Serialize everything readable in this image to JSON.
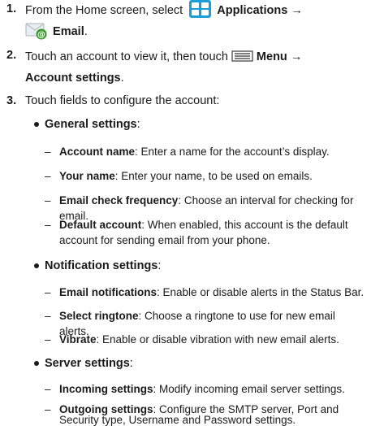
{
  "steps": [
    {
      "number": "1.",
      "line1_prefix": "From the Home screen, select",
      "applications_label": "Applications",
      "arrow": "→",
      "email_label": "Email",
      "line2_suffix": "."
    },
    {
      "number": "2.",
      "prefix": "Touch an account to view it, then touch",
      "menu_label": "Menu",
      "arrow": "→",
      "account_settings_label": "Account settings",
      "suffix": "."
    },
    {
      "number": "3.",
      "text": "Touch fields to configure the account:"
    }
  ],
  "sections": {
    "general": {
      "title": "General settings",
      "colon": ":",
      "items": [
        {
          "term": "Account name",
          "desc": ": Enter a name for the account’s display."
        },
        {
          "term": "Your name",
          "desc": ": Enter your name, to be used on emails."
        },
        {
          "term": "Email check frequency",
          "desc": ": Choose an interval for checking for email."
        },
        {
          "term": "Default account",
          "desc": ": When enabled, this account is the default account for sending email from your phone."
        }
      ]
    },
    "notification": {
      "title": "Notification settings",
      "colon": ":",
      "items": [
        {
          "term": "Email notifications",
          "desc": ": Enable or disable alerts in the Status Bar."
        },
        {
          "term": "Select ringtone",
          "desc": ": Choose a ringtone to use for new email alerts."
        },
        {
          "term": "Vibrate",
          "desc": ": Enable or disable vibration with new email alerts."
        }
      ]
    },
    "server": {
      "title": "Server settings",
      "colon": ":",
      "items": [
        {
          "term": "Incoming settings",
          "desc": ": Modify incoming email server settings."
        },
        {
          "term": "Outgoing settings",
          "desc": ": Configure the SMTP server, Port and Security type, Username and Password settings."
        }
      ]
    }
  },
  "dash": "–",
  "icons": {
    "applications": "applications-grid-icon",
    "email": "email-envelope-icon",
    "menu": "menu-icon"
  },
  "colors": {
    "applications_icon": "#1a9fd8",
    "email_at": "#3a9a2a",
    "text": "#1a1a1a"
  }
}
